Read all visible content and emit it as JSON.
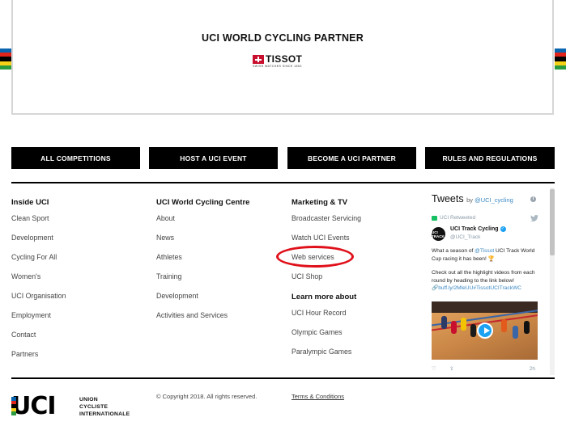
{
  "partner": {
    "title": "UCI WORLD CYCLING PARTNER",
    "brand": "TISSOT",
    "brand_tagline": "SWISS WATCHES SINCE 1853"
  },
  "buttons": [
    {
      "label": "ALL COMPETITIONS"
    },
    {
      "label": "HOST A UCI EVENT"
    },
    {
      "label": "BECOME A UCI PARTNER"
    },
    {
      "label": "RULES AND REGULATIONS"
    }
  ],
  "columns": {
    "inside": {
      "title": "Inside UCI",
      "links": [
        "Clean Sport",
        "Development",
        "Cycling For All",
        "Women's",
        "UCI Organisation",
        "Employment",
        "Contact",
        "Partners"
      ]
    },
    "centre": {
      "title": "UCI World Cycling Centre",
      "links": [
        "About",
        "News",
        "Athletes",
        "Training",
        "Development",
        "Activities and Services"
      ]
    },
    "marketing": {
      "title": "Marketing & TV",
      "links": [
        "Broadcaster Servicing",
        "Watch UCI Events",
        "Web services",
        "UCI Shop"
      ],
      "learn_title": "Learn more about",
      "learn_links": [
        "UCI Hour Record",
        "Olympic Games",
        "Paralympic Games"
      ]
    }
  },
  "twitter": {
    "title": "Tweets",
    "by_prefix": "by ",
    "by_handle": "@UCI_cycling",
    "retweeted": "UCI Retweeted",
    "author_name": "UCI Track Cycling",
    "author_handle": "@UCI_Track",
    "avatar_text": "UCI TRACK",
    "text_1a": "What a season of ",
    "text_1b": "@Tissot",
    "text_1c": " UCI Track World Cup racing it has been! 🏆",
    "text_2": "Check out all the highlight videos from each round by heading to the link below!",
    "text_link": "🔗buff.ly/2MleUU",
    "text_hashtags": "#TissotUCITrackWC",
    "time": "2h"
  },
  "footer": {
    "org_line1": "UNION",
    "org_line2": "CYCLISTE",
    "org_line3": "INTERNATIONALE",
    "logo_text": "UCI",
    "copyright": "© Copyright 2018. All rights reserved.",
    "terms": "Terms & Conditions"
  },
  "colors": {
    "rainbow": [
      "#0a65b0",
      "#e2231a",
      "#000000",
      "#f7d117",
      "#2a9b3f"
    ],
    "highlight": "#e0101a",
    "link_blue": "#3b88c3"
  }
}
